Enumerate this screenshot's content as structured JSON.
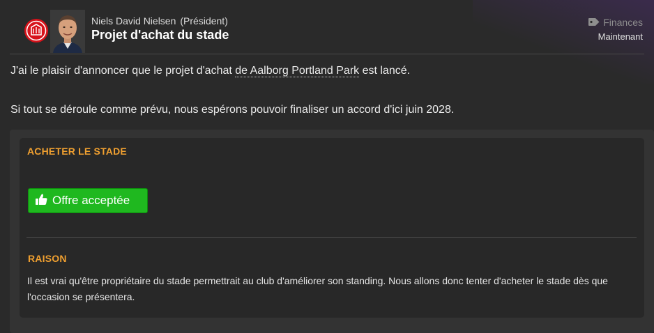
{
  "header": {
    "sender_name": "Niels David Nielsen",
    "sender_role": "(Président)",
    "subject": "Projet d'achat du stade",
    "category": "Finances",
    "category_icon": "tag-icon",
    "time": "Maintenant",
    "crest_icon": "club-crest-icon",
    "crest_color": "#d7121a"
  },
  "body": {
    "para1_prefix": "J'ai le plaisir d'annoncer que le projet d'achat ",
    "para1_link": "de Aalborg Portland Park",
    "para1_suffix": " est lancé.",
    "para2": "Si tout se déroule comme prévu, nous espérons pouvoir finaliser un accord d'ici juin 2028."
  },
  "panel": {
    "section1_title": "ACHETER LE STADE",
    "accept_button_label": "Offre acceptée",
    "accept_button_icon": "thumbs-up-icon",
    "accept_button_color": "#1fb81f",
    "section2_title": "RAISON",
    "reason_text": "Il est vrai qu'être propriétaire du stade permettrait au club d'améliorer son standing. Nous allons donc tenter d'acheter le stade dès que l'occasion se présentera."
  },
  "colors": {
    "background": "#2a2a2a",
    "panel": "#282828",
    "accent_orange": "#f0a030"
  }
}
